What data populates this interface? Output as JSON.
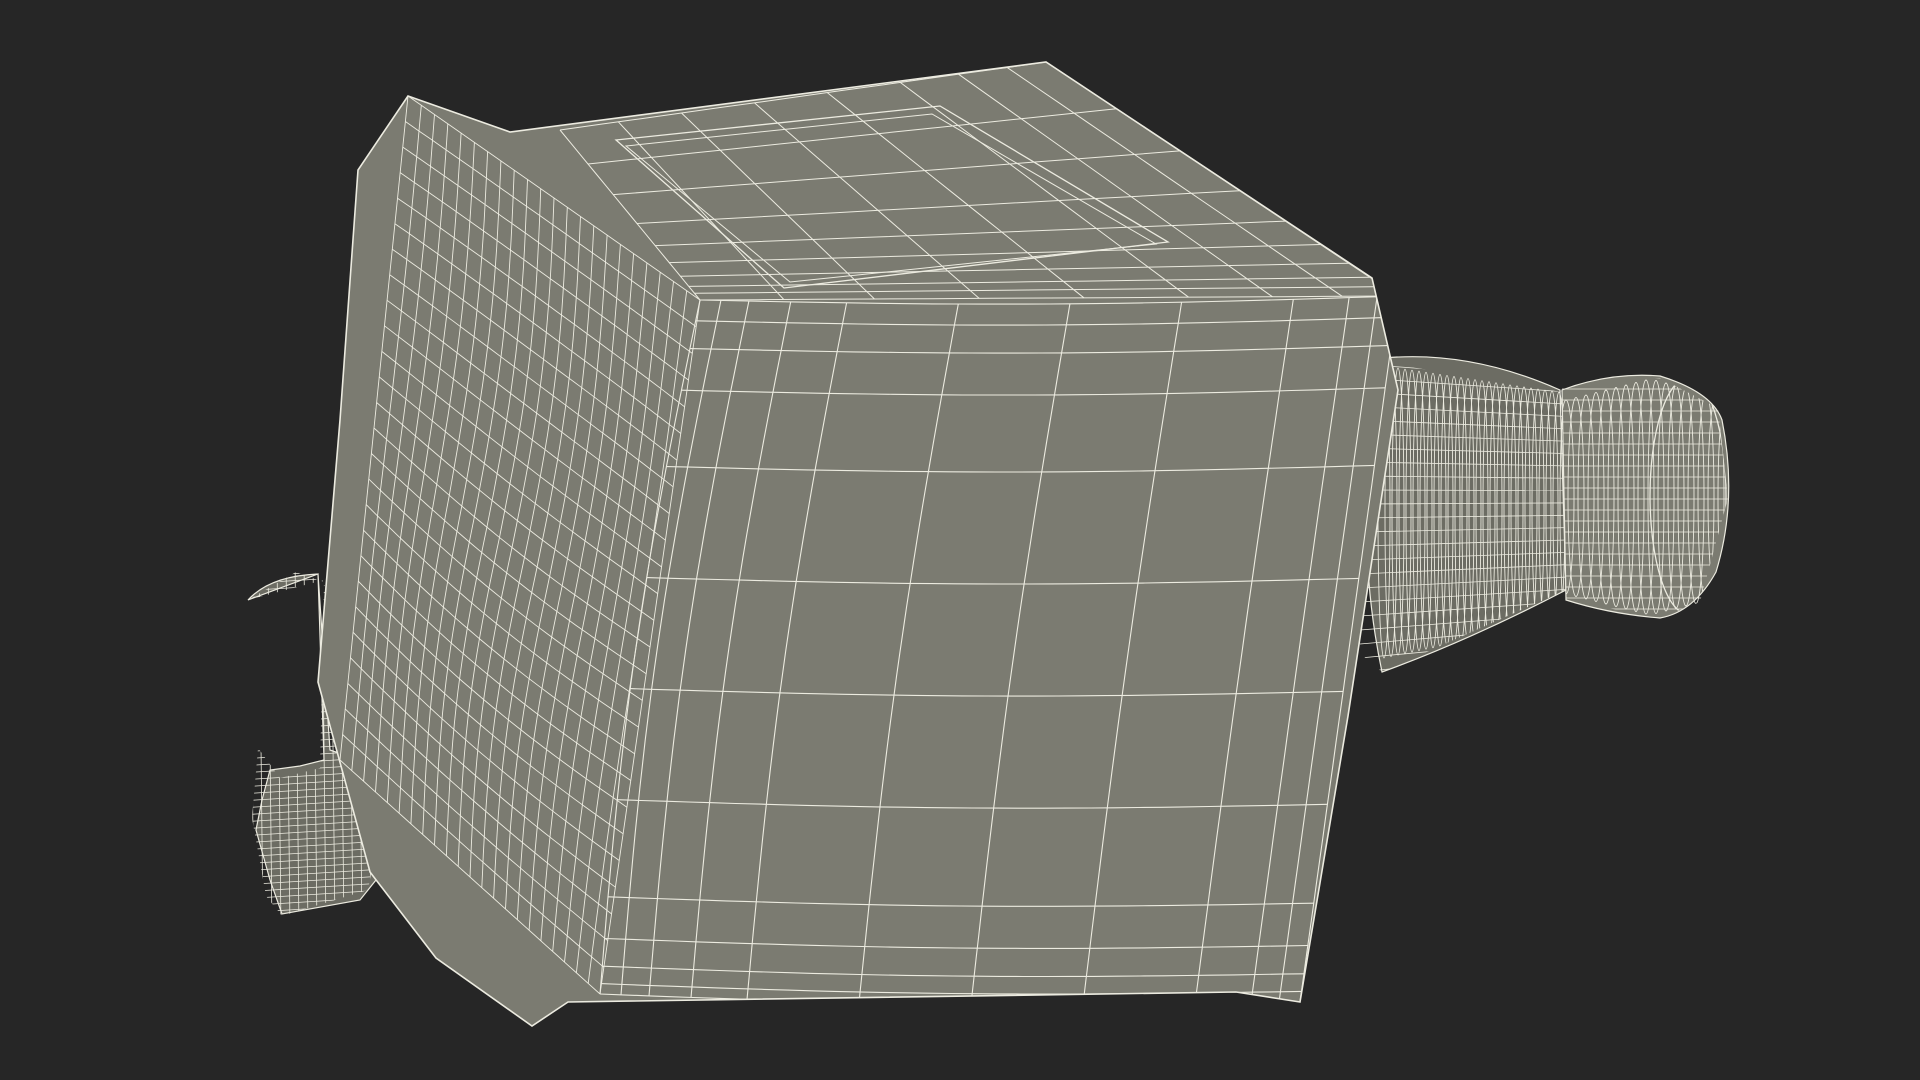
{
  "scene": {
    "background_color": "#262626",
    "surface_color": "#7b7b71",
    "surface_shadow_color": "#6c6c63",
    "wire_color": "#ecebe0",
    "subject": "wireframe-bottle-model"
  }
}
